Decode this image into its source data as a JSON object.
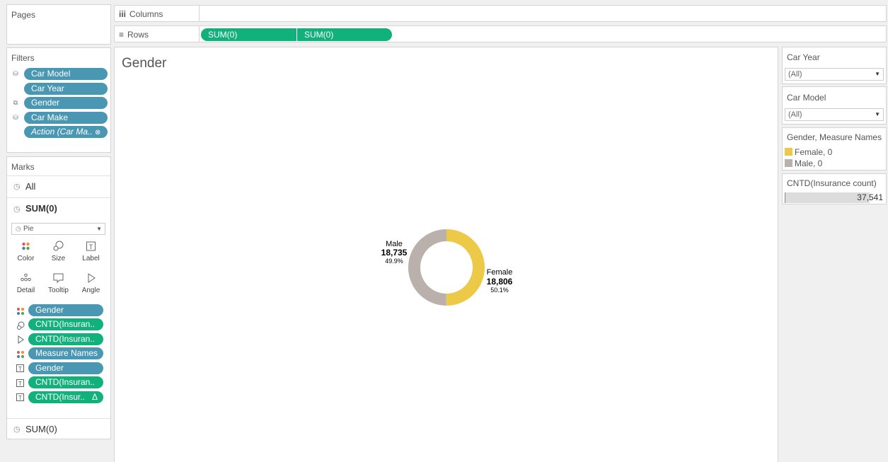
{
  "shelves": {
    "pages_title": "Pages",
    "columns_label": "Columns",
    "rows_label": "Rows",
    "rows_pills": [
      "SUM(0)",
      "SUM(0)"
    ]
  },
  "filters": {
    "title": "Filters",
    "items": [
      {
        "label": "Car Model",
        "icon": "database-icon"
      },
      {
        "label": "Car Year",
        "icon": ""
      },
      {
        "label": "Gender",
        "icon": "multi-database-icon"
      },
      {
        "label": "Car Make",
        "icon": "database-icon"
      },
      {
        "label": "Action (Car Ma..",
        "icon": "link-icon"
      }
    ]
  },
  "marks": {
    "title": "Marks",
    "all_label": "All",
    "sum_label": "SUM(0)",
    "mark_type": "Pie",
    "buttons": [
      "Color",
      "Size",
      "Label",
      "Detail",
      "Tooltip",
      "Angle"
    ],
    "pills": [
      {
        "label": "Gender",
        "kind": "blue",
        "icon": "color-dots-icon"
      },
      {
        "label": "CNTD(Insuran..",
        "kind": "green",
        "icon": "size-icon"
      },
      {
        "label": "CNTD(Insuran..",
        "kind": "green",
        "icon": "angle-icon"
      },
      {
        "label": "Measure Names",
        "kind": "blue",
        "icon": "color-dots-icon"
      },
      {
        "label": "Gender",
        "kind": "blue",
        "icon": "label-icon"
      },
      {
        "label": "CNTD(Insuran..",
        "kind": "green",
        "icon": "label-icon"
      },
      {
        "label": "CNTD(Insur..",
        "kind": "green",
        "icon": "label-icon",
        "suffix": "Δ"
      }
    ],
    "bottom_label": "SUM(0)"
  },
  "view": {
    "title": "Gender"
  },
  "chart_data": {
    "type": "pie",
    "categories": [
      "Male",
      "Female"
    ],
    "values": [
      18735,
      18806
    ],
    "value_labels": [
      "18,735",
      "18,806"
    ],
    "percent_labels": [
      "49.9%",
      "50.1%"
    ],
    "colors": [
      "#bab0ac",
      "#edc948"
    ]
  },
  "right": {
    "car_year_title": "Car Year",
    "car_year_value": "(All)",
    "car_model_title": "Car Model",
    "car_model_value": "(All)",
    "legend_title": "Gender, Measure Names",
    "legend": [
      {
        "label": "Female, 0",
        "color": "#edc948"
      },
      {
        "label": "Male, 0",
        "color": "#bab0ac"
      }
    ],
    "size_title": "CNTD(Insurance count)",
    "size_value": "37,541"
  }
}
